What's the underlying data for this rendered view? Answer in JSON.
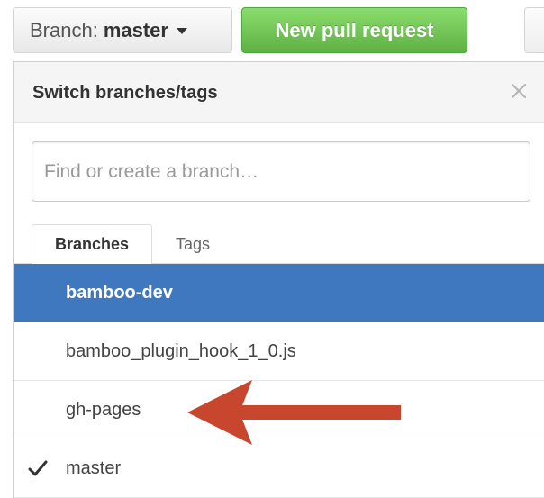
{
  "toolbar": {
    "branch_prefix": "Branch:",
    "branch_name": "master",
    "new_pr_label": "New pull request"
  },
  "dropdown": {
    "title": "Switch branches/tags",
    "filter_placeholder": "Find or create a branch…",
    "tabs": [
      {
        "label": "Branches",
        "active": true
      },
      {
        "label": "Tags",
        "active": false
      }
    ],
    "items": [
      {
        "label": "bamboo-dev",
        "highlighted": true,
        "selected": false
      },
      {
        "label": "bamboo_plugin_hook_1_0.js",
        "highlighted": false,
        "selected": false
      },
      {
        "label": "gh-pages",
        "highlighted": false,
        "selected": false
      },
      {
        "label": "master",
        "highlighted": false,
        "selected": true
      }
    ]
  },
  "annotation": {
    "icon": "red-arrow-icon",
    "color": "#c8462e"
  },
  "colors": {
    "accent": "#4078c0",
    "primary_button": "#6cc644",
    "arrow": "#c8462e"
  }
}
